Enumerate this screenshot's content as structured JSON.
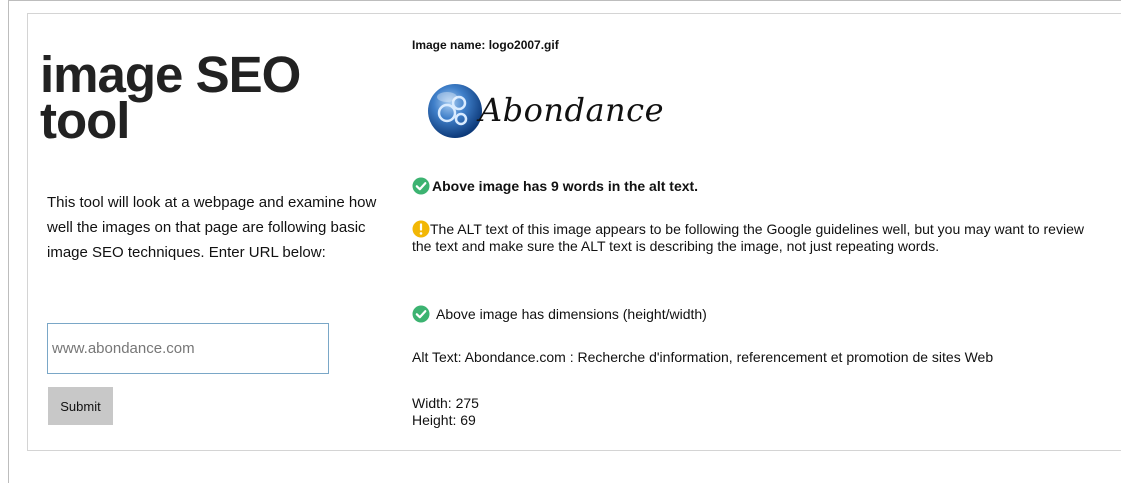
{
  "tool": {
    "title": "image SEO tool",
    "intro": "This tool will look at a webpage and examine how well the images on that page are following basic image SEO techniques. Enter URL below:",
    "url_placeholder": "www.abondance.com",
    "submit_label": "Submit"
  },
  "result": {
    "image_name": "Image name: logo2007.gif",
    "logo_text": "Abondance",
    "alt_word_count": "Above image has 9 words in the alt text.",
    "alt_warning": "The ALT text of this image appears to be following the Google guidelines well, but you may want to review the text and make sure the ALT text is describing the image, not just repeating words.",
    "dimensions_check": "Above image has dimensions (height/width)",
    "alt_text": "Alt Text: Abondance.com : Recherche d'information, referencement et promotion de sites Web",
    "width": "Width: 275",
    "height": "Height: 69"
  },
  "icons": {
    "success": "check-circle-icon",
    "warning": "exclamation-circle-icon"
  },
  "colors": {
    "success_green": "#3cb371",
    "warning_yellow": "#f2b705",
    "input_border": "#7aa7c7",
    "button_bg": "#c8c8c8"
  }
}
